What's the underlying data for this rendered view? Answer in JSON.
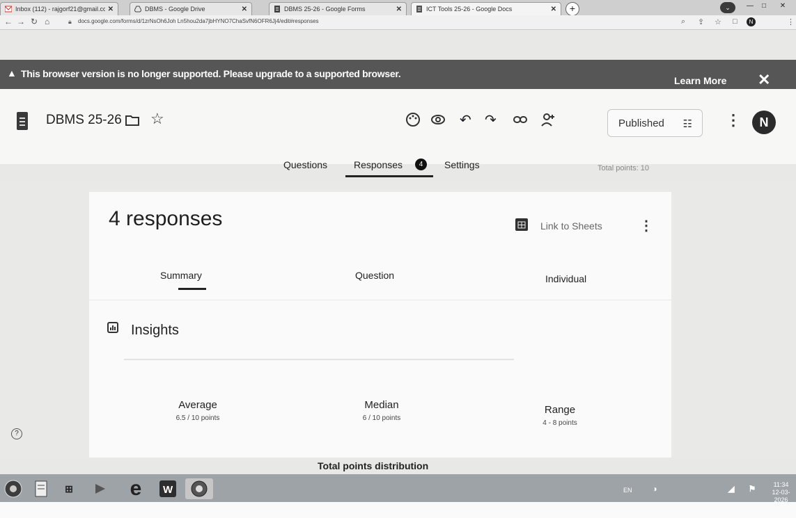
{
  "browser": {
    "tabs": [
      {
        "label": "Inbox (112) - rajgorf21@gmail.co",
        "icon": "gmail-icon",
        "active": false
      },
      {
        "label": "DBMS - Google Drive",
        "icon": "drive-icon",
        "active": false
      },
      {
        "label": "DBMS 25-26 - Google Forms",
        "icon": "forms-icon",
        "active": false
      },
      {
        "label": "ICT Tools 25-26 - Google Docs",
        "icon": "docs-icon",
        "active": true
      }
    ],
    "url": "docs.google.com/forms/d/1zrNsOh6Joh Ln5hou2da7jbHYNO7ChaSvfN6OFR6Jj4/edit#responses",
    "profile_initial": "N"
  },
  "warning": {
    "message": "This browser version is no longer supported. Please upgrade to a supported browser.",
    "learn_more": "Learn More"
  },
  "header": {
    "title": "DBMS 25-26",
    "published_label": "Published",
    "avatar_initial": "N"
  },
  "main_tabs": {
    "questions": "Questions",
    "responses": "Responses",
    "responses_count": "4",
    "settings": "Settings",
    "total_points": "Total points: 10"
  },
  "responses": {
    "title": "4 responses",
    "link_to_sheets": "Link to Sheets",
    "subtabs": {
      "summary": "Summary",
      "question": "Question",
      "individual": "Individual"
    }
  },
  "insights": {
    "title": "Insights",
    "average_label": "Average",
    "average_value": "6.5 / 10 points",
    "median_label": "Median",
    "median_value": "6 / 10 points",
    "range_label": "Range",
    "range_value": "4 - 8 points",
    "distribution_title": "Total points distribution"
  },
  "taskbar": {
    "lang": "EN",
    "time": "11:34",
    "date": "12-03-2026"
  },
  "colors": {
    "warning_bg": "#565656",
    "accent": "#222222"
  }
}
